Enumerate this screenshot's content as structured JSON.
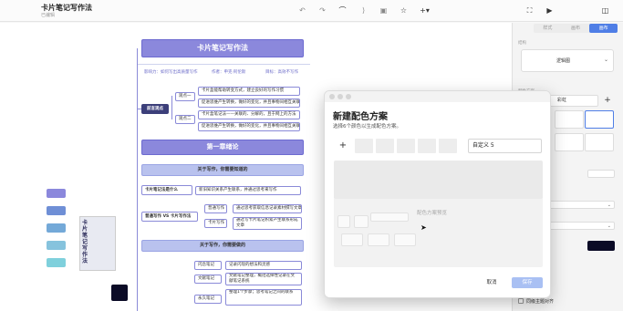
{
  "document": {
    "title": "卡片笔记写作法",
    "subtitle": "已编辑"
  },
  "toolbar": {
    "icons": [
      "undo-icon",
      "redo-icon",
      "connect-icon",
      "summary-icon",
      "image-icon",
      "star-icon",
      "insert-plus-icon",
      "fullscreen-icon",
      "present-icon",
      "sidebar-toggle-icon"
    ]
  },
  "mindmap": {
    "root": "卡片笔记写作法",
    "tags": [
      "影响力：如何写出高质量写作",
      "作者：申克·阿伦斯",
      "目标：高效不写作"
    ],
    "branch_1": {
      "label": "前言观点",
      "sub_1": "观点一",
      "sub_2": "观点二",
      "items": [
        "卡片盒能帮助转变方式，建立良好的写作习惯",
        "促进思维产生转换，做好的变化，并且事物间相互关联",
        "卡片盒笔记法——关联的、分解的，且于网上的方法",
        "促进思维产生转换，做好的变化，并且事物间相互关联"
      ]
    },
    "chapter_1": "第一章绪论",
    "section_1": "关于写作，你需要知道的",
    "node_a": "卡片笔记法是什么",
    "node_a_item": "新旧知识关系产生联系，并通过思考来写作",
    "node_b": "普通写作 VS 卡片写作法",
    "node_b_sub_1": "普通写作",
    "node_b_sub_2": "卡片写作",
    "node_b_items": [
      "通过思考获取信息记录素材撰写文章",
      "通过写卡片笔记积累产生联系形成文章"
    ],
    "section_2": "关于写作，你需要做的",
    "notes": [
      {
        "label": "闪念笔记",
        "text": "记录闪现的想法和灵感"
      },
      {
        "label": "文献笔记",
        "text": "文献笔记整理，概括选择性记录在文献笔记系统"
      },
      {
        "label": "永久笔记",
        "text": "整理1个步骤；思考笔记之间的联系"
      }
    ],
    "book_cover_title": "卡片笔记写作法",
    "swatch_colors": [
      "#8b88dc",
      "#6f8fd6",
      "#74a9d8",
      "#86c3dd",
      "#7fd0dc"
    ]
  },
  "right_panel": {
    "tabs": [
      "样式",
      "画布",
      "画布"
    ],
    "active_tab": 2,
    "tab_labels": {
      "style": "样式",
      "canvas": "画布",
      "color": "画布"
    },
    "structure_label": "结构",
    "layout_value": "逻辑图",
    "color_scheme_label": "配色方案",
    "theme_value": "彩虹",
    "options": [
      {
        "label": "同级主题对齐",
        "checked": false
      }
    ]
  },
  "dialog": {
    "title": "新建配色方案",
    "description": "选择6个颜色以生成配色方案。",
    "add_label": "+",
    "name_value": "自定义 5",
    "preview_placeholder": "配色方案预览",
    "cancel_label": "取消",
    "save_label": "保存"
  }
}
